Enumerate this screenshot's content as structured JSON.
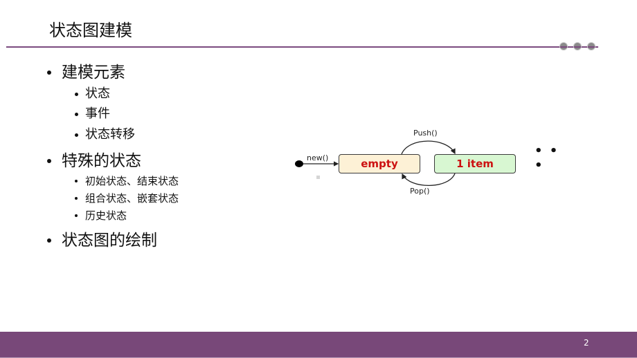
{
  "slide": {
    "title": "状态图建模",
    "page_number": "2",
    "colors": {
      "accent": "#784879",
      "state_empty_fill": "#fdf1d6",
      "state_item_fill": "#d8f7d2",
      "state_text": "#cc1111"
    }
  },
  "bullets": [
    {
      "text": "建模元素",
      "children": [
        "状态",
        "事件",
        "状态转移"
      ]
    },
    {
      "text": "特殊的状态",
      "children": [
        "初始状态、结束状态",
        "组合状态、嵌套状态",
        "历史状态"
      ]
    },
    {
      "text": "状态图的绘制",
      "children": []
    }
  ],
  "diagram": {
    "initial_transition_label": "new()",
    "states": [
      {
        "name": "empty"
      },
      {
        "name": "1 item"
      }
    ],
    "transitions": [
      {
        "from": "empty",
        "to": "1 item",
        "label": "Push()"
      },
      {
        "from": "1 item",
        "to": "empty",
        "label": "Pop()"
      }
    ],
    "continuation": "• • •"
  }
}
